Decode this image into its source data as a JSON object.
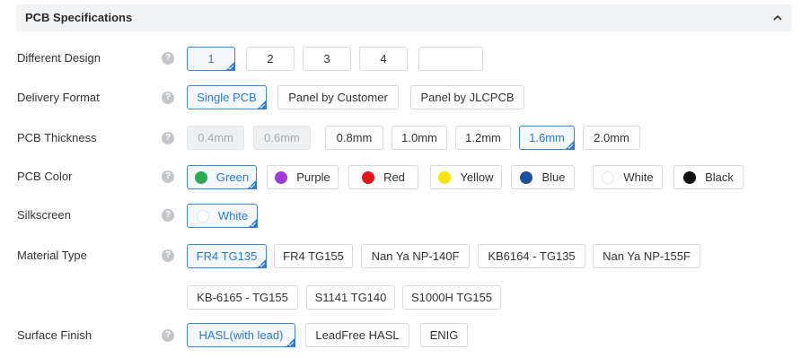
{
  "section": {
    "title": "PCB Specifications",
    "collapse_icon": "chevron-up-icon"
  },
  "rows": {
    "design": {
      "label": "Different Design",
      "options": [
        "1",
        "2",
        "3",
        "4",
        ""
      ],
      "selected": "1"
    },
    "delivery": {
      "label": "Delivery Format",
      "options": [
        "Single PCB",
        "Panel by Customer",
        "Panel by JLCPCB"
      ],
      "selected": "Single PCB"
    },
    "thickness": {
      "label": "PCB Thickness",
      "options": [
        "0.4mm",
        "0.6mm",
        "0.8mm",
        "1.0mm",
        "1.2mm",
        "1.6mm",
        "2.0mm"
      ],
      "disabled": [
        "0.4mm",
        "0.6mm"
      ],
      "selected": "1.6mm"
    },
    "color": {
      "label": "PCB Color",
      "options": [
        "Green",
        "Purple",
        "Red",
        "Yellow",
        "Blue",
        "White",
        "Black"
      ],
      "swatches": [
        "#2aa853",
        "#a23bd9",
        "#e0141b",
        "#f5e30a",
        "#1f4fa1",
        "#ffffff",
        "#111111"
      ],
      "selected": "Green"
    },
    "silkscreen": {
      "label": "Silkscreen",
      "options": [
        "White"
      ],
      "swatches": [
        "#ffffff"
      ],
      "selected": "White"
    },
    "material": {
      "label": "Material Type",
      "options": [
        "FR4 TG135",
        "FR4 TG155",
        "Nan Ya NP-140F",
        "KB6164 - TG135",
        "Nan Ya NP-155F",
        "KB-6165 - TG155",
        "S1141 TG140",
        "S1000H TG155"
      ],
      "selected": "FR4 TG135"
    },
    "finish": {
      "label": "Surface Finish",
      "options": [
        "HASL(with lead)",
        "LeadFree HASL",
        "ENIG"
      ],
      "selected": "HASL(with lead)"
    }
  },
  "help_icon": {
    "glyph": "?",
    "icon": "help-circle-icon"
  },
  "colors": {
    "accent": "#2a7ad6",
    "border": "#d6d9dd",
    "header_bg": "#f2f3f5"
  }
}
